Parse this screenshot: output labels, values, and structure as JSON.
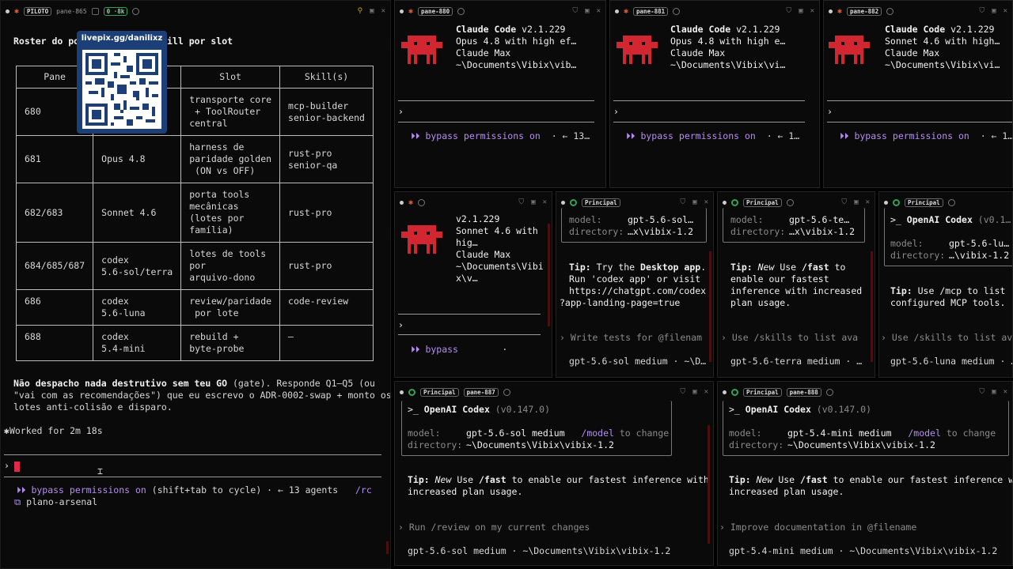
{
  "colors": {
    "accent_purple": "#b58df0",
    "robot_red": "#d22630",
    "cursor_red": "#e0294a",
    "green": "#2fa35a"
  },
  "left": {
    "header": {
      "pilot_tag": "PILOTO",
      "pane": "pane-865",
      "counter": "0 ·8k"
    },
    "heading": "Roster do po",
    "heading_tail": "ill por slot",
    "qr": {
      "label": "livepix.gg/danilixz"
    },
    "table": {
      "headers": [
        "Pane",
        "",
        "Slot",
        "Skill(s)"
      ],
      "rows": [
        [
          "680",
          "",
          "transporte core\n + ToolRouter\ncentral",
          "mcp-builder\nsenior-backend"
        ],
        [
          "681",
          "Opus 4.8",
          "harness de\nparidade golden\n (ON vs OFF)",
          "rust-pro\nsenior-qa"
        ],
        [
          "682/683",
          "Sonnet 4.6",
          "porta tools\nmecânicas\n(lotes por\nfamília)",
          "rust-pro"
        ],
        [
          "684/685/687",
          "codex\n5.6-sol/terra",
          "lotes de tools\npor\narquivo-dono",
          "rust-pro"
        ],
        [
          "686",
          "codex\n5.6-luna",
          "review/paridade\n por lote",
          "code-review"
        ],
        [
          "688",
          "codex\n5.4-mini",
          "rebuild +\nbyte-probe",
          "—"
        ]
      ]
    },
    "para_bold": "Não despacho nada destrutivo sem teu GO",
    "para_rest1": " (gate). Responde Q1–Q5 (ou",
    "para_line2": "\"vai com as recomendações\") que eu escrevo o ADR-0002-swap + monto os",
    "para_line3": "lotes anti-colisão e disparo.",
    "worked": "Worked for 2m 18s",
    "prompt": "›",
    "status_bypass": "bypass permissions on",
    "status_rest": " (shift+tab to cycle) · ← 13 agents",
    "status_rc": "/rc",
    "status_branch": "plano-arsenal"
  },
  "p880": {
    "pane": "pane-880",
    "title": "Claude Code",
    "version": " v2.1.229",
    "model": "Opus 4.8 with high ef…",
    "plan": "Claude Max",
    "path": "~\\Documents\\Vibix\\vib…",
    "prompt": "›",
    "status": "bypass permissions on",
    "status_rest": "  · ← 13…"
  },
  "p881": {
    "pane": "pane-881",
    "title": "Claude Code",
    "version": " v2.1.229",
    "model": "Opus 4.8 with high e…",
    "plan": "Claude Max",
    "path": "~\\Documents\\Vibix\\vi…",
    "prompt": "›",
    "status": "bypass permissions on",
    "status_rest": "  · ← 1…"
  },
  "p882": {
    "pane": "pane-882",
    "title": "Claude Code",
    "version": " v2.1.229",
    "model": "Sonnet 4.6 with high…",
    "plan": "Claude Max",
    "path": "~\\Documents\\Vibix\\vi…",
    "prompt": "›",
    "status": "bypass permissions on",
    "status_rest": "  · ← 1…"
  },
  "p883": {
    "version": "v2.1.229",
    "model1": "Sonnet 4.6 with",
    "model2": "hig…",
    "plan": "Claude Max",
    "path1": "~\\Documents\\Vibi",
    "path2": "x\\v…",
    "prompt": "›",
    "status": "bypass",
    "status_rest": "        ·"
  },
  "p884": {
    "tag": "Principal",
    "model_label": "model:",
    "model_val": "gpt-5.6-sol…",
    "dir_label": "directory:",
    "dir_val": "…x\\vibix-1.2",
    "tip_label": "Tip:",
    "tip1_a": " Try the ",
    "tip1_b": "Desktop app",
    "tip1_c": ".",
    "tip2": "Run 'codex app' or visit",
    "tip3": "https://chatgpt.com/codex",
    "tip4": "?app-landing-page=true",
    "suggest": "Write tests for @filenam",
    "status": "gpt-5.6-sol medium · ~\\D…"
  },
  "p885": {
    "tag": "Principal",
    "model_label": "model:",
    "model_val": "gpt-5.6-te…",
    "dir_label": "directory:",
    "dir_val": "…x\\vibix-1.2",
    "tip_label": "Tip:",
    "tip1_a": " New",
    "tip1_b": " Use ",
    "tip1_c": "/fast",
    "tip1_d": " to",
    "tip2": "enable our fastest",
    "tip3": "inference with increased",
    "tip4": "plan usage.",
    "suggest": "Use /skills to list ava",
    "status": "gpt-5.6-terra medium · …"
  },
  "p886": {
    "tag": "Principal",
    "title": "OpenAI Codex",
    "version": " (v0.1…",
    "model_label": "model:",
    "model_val": "gpt-5.6-lu…",
    "dir_label": "directory:",
    "dir_val": "…\\vibix-1.2",
    "tip_label": "Tip:",
    "tip1": " Use /mcp to list",
    "tip2": "configured MCP tools.",
    "suggest": "Use /skills to list ava",
    "status": "gpt-5.6-luna medium · …"
  },
  "p887": {
    "tag": "Principal",
    "pane": "pane-887",
    "title": "OpenAI Codex",
    "version": " (v0.147.0)",
    "model_label": "model:",
    "model_val": "gpt-5.6-sol medium",
    "model_hint_cmd": "/model",
    "model_hint": " to change",
    "dir_label": "directory:",
    "dir_val": "~\\Documents\\Vibix\\vibix-1.2",
    "tip_label": "Tip:",
    "tip_new": " New",
    "tip_use": " Use ",
    "tip_fast": "/fast",
    "tip_rest": " to enable our fastest inference with",
    "tip2": "increased plan usage.",
    "suggest": "Run /review on my current changes",
    "status": "gpt-5.6-sol medium · ~\\Documents\\Vibix\\vibix-1.2"
  },
  "p888": {
    "tag": "Principal",
    "pane": "pane-888",
    "title": "OpenAI Codex",
    "version": " (v0.147.0)",
    "model_label": "model:",
    "model_val": "gpt-5.4-mini medium",
    "model_hint_cmd": "/model",
    "model_hint": " to change",
    "dir_label": "directory:",
    "dir_val": "~\\Documents\\Vibix\\vibix-1.2",
    "tip_label": "Tip:",
    "tip_new": " New",
    "tip_use": " Use ",
    "tip_fast": "/fast",
    "tip_rest": " to enable our fastest inference wit",
    "tip2": "increased plan usage.",
    "suggest": "Improve documentation in @filename",
    "status": "gpt-5.4-mini medium · ~\\Documents\\Vibix\\vibix-1.2"
  }
}
